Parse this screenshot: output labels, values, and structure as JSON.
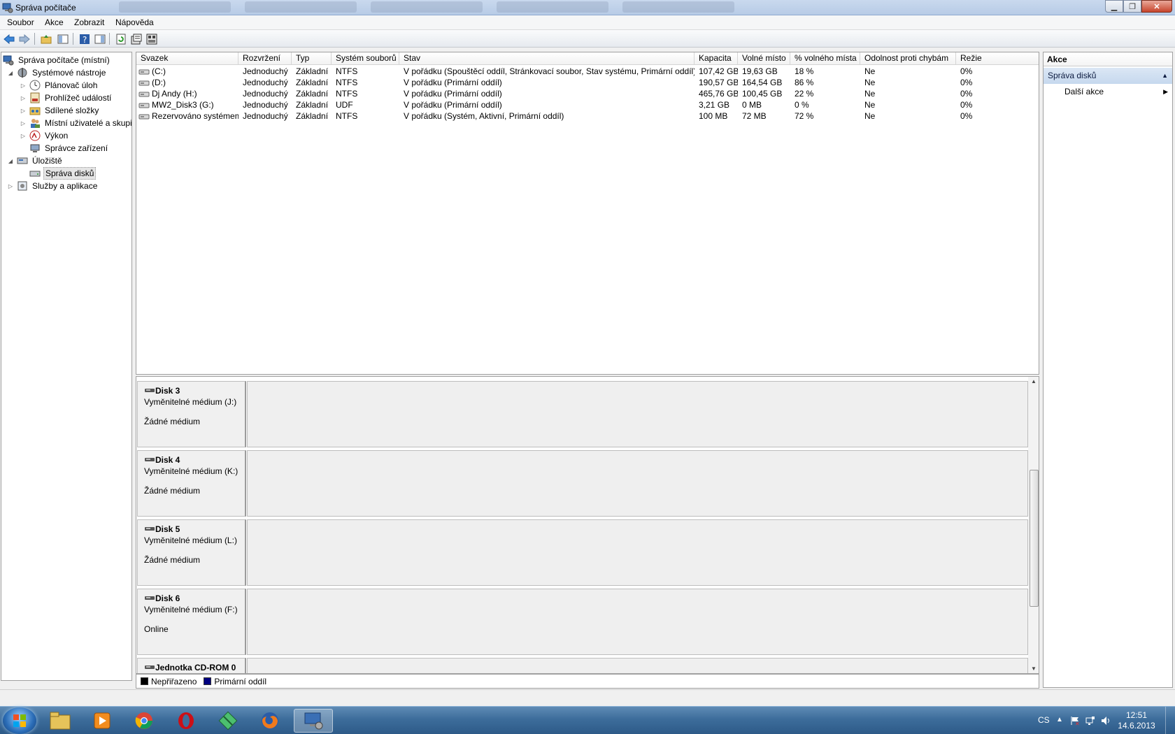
{
  "window": {
    "title": "Správa počítače"
  },
  "menu": [
    "Soubor",
    "Akce",
    "Zobrazit",
    "Nápověda"
  ],
  "tree": {
    "items": [
      {
        "label": "Správa počítače (místní)",
        "level": 0,
        "expander": "",
        "icon": "computer-management-icon"
      },
      {
        "label": "Systémové nástroje",
        "level": 1,
        "expander": "◢",
        "icon": "system-tools-icon"
      },
      {
        "label": "Plánovač úloh",
        "level": 2,
        "expander": "▷",
        "icon": "clock-icon"
      },
      {
        "label": "Prohlížeč událostí",
        "level": 2,
        "expander": "▷",
        "icon": "event-viewer-icon"
      },
      {
        "label": "Sdílené složky",
        "level": 2,
        "expander": "▷",
        "icon": "shared-folder-icon"
      },
      {
        "label": "Místní uživatelé a skupiny",
        "level": 2,
        "expander": "▷",
        "icon": "users-icon"
      },
      {
        "label": "Výkon",
        "level": 2,
        "expander": "▷",
        "icon": "performance-icon"
      },
      {
        "label": "Správce zařízení",
        "level": 2,
        "expander": "",
        "icon": "device-manager-icon"
      },
      {
        "label": "Úložiště",
        "level": 1,
        "expander": "◢",
        "icon": "storage-icon"
      },
      {
        "label": "Správa disků",
        "level": 2,
        "expander": "",
        "icon": "disk-management-icon",
        "selected": true
      },
      {
        "label": "Služby a aplikace",
        "level": 1,
        "expander": "▷",
        "icon": "services-icon"
      }
    ]
  },
  "volumes": {
    "columns": [
      "Svazek",
      "Rozvržení",
      "Typ",
      "Systém souborů",
      "Stav",
      "Kapacita",
      "Volné místo",
      "% volného místa",
      "Odolnost proti chybám",
      "Režie"
    ],
    "rows": [
      [
        "(C:)",
        "Jednoduchý",
        "Základní",
        "NTFS",
        "V pořádku (Spouštěcí oddíl, Stránkovací soubor, Stav systému, Primární oddíl)",
        "107,42 GB",
        "19,63 GB",
        "18 %",
        "Ne",
        "0%"
      ],
      [
        "(D:)",
        "Jednoduchý",
        "Základní",
        "NTFS",
        "V pořádku (Primární oddíl)",
        "190,57 GB",
        "164,54 GB",
        "86 %",
        "Ne",
        "0%"
      ],
      [
        "Dj Andy (H:)",
        "Jednoduchý",
        "Základní",
        "NTFS",
        "V pořádku (Primární oddíl)",
        "465,76 GB",
        "100,45 GB",
        "22 %",
        "Ne",
        "0%"
      ],
      [
        "MW2_Disk3 (G:)",
        "Jednoduchý",
        "Základní",
        "UDF",
        "V pořádku (Primární oddíl)",
        "3,21 GB",
        "0 MB",
        "0 %",
        "Ne",
        "0%"
      ],
      [
        "Rezervováno systémem",
        "Jednoduchý",
        "Základní",
        "NTFS",
        "V pořádku (Systém, Aktivní, Primární oddíl)",
        "100 MB",
        "72 MB",
        "72 %",
        "Ne",
        "0%"
      ]
    ]
  },
  "disks": [
    {
      "name": "Disk 3",
      "type": "Vyměnitelné médium (J:)",
      "state": "Žádné médium"
    },
    {
      "name": "Disk 4",
      "type": "Vyměnitelné médium (K:)",
      "state": "Žádné médium"
    },
    {
      "name": "Disk 5",
      "type": "Vyměnitelné médium (L:)",
      "state": "Žádné médium"
    },
    {
      "name": "Disk 6",
      "type": "Vyměnitelné médium (F:)",
      "state": "Online"
    },
    {
      "name": "Jednotka CD-ROM 0",
      "type": "",
      "state": ""
    }
  ],
  "legend": [
    {
      "label": "Nepřiřazeno",
      "color": "#000000"
    },
    {
      "label": "Primární oddíl",
      "color": "#000080"
    }
  ],
  "actions": {
    "header": "Akce",
    "section": "Správa disků",
    "item": "Další akce"
  },
  "taskbar": {
    "lang": "CS",
    "time": "12:51",
    "date": "14.6.2013",
    "apps": [
      "explorer-icon",
      "media-player-icon",
      "chrome-icon",
      "opera-icon",
      "network-app-icon",
      "firefox-icon",
      "computer-management-icon"
    ]
  }
}
